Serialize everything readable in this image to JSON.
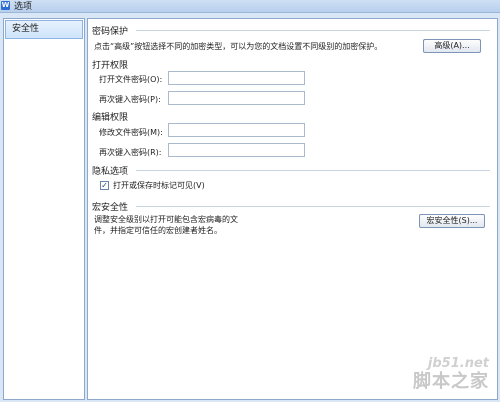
{
  "window": {
    "title": "选项"
  },
  "sidebar": {
    "items": [
      {
        "label": "安全性"
      }
    ]
  },
  "password_protection": {
    "title": "密码保护",
    "description": "点击“高级”按钮选择不同的加密类型，可以为您的文档设置不同级别的加密保护。",
    "advanced_button": "高级(A)..."
  },
  "open_permission": {
    "title": "打开权限",
    "password_label": "打开文件密码(O):",
    "password_value": "",
    "confirm_label": "再次键入密码(P):",
    "confirm_value": ""
  },
  "edit_permission": {
    "title": "编辑权限",
    "password_label": "修改文件密码(M):",
    "password_value": "",
    "confirm_label": "再次键入密码(R):",
    "confirm_value": ""
  },
  "privacy": {
    "title": "隐私选项",
    "checkbox_label": "打开或保存时标记可见(V)",
    "checked": true
  },
  "macro": {
    "title": "宏安全性",
    "description_line1": "调整安全级别以打开可能包含宏病毒的文",
    "description_line2": "件，并指定可信任的宏创建者姓名。",
    "button": "宏安全性(S)..."
  },
  "watermark": {
    "line1": "jb51.net",
    "line2": "脚本之家"
  }
}
